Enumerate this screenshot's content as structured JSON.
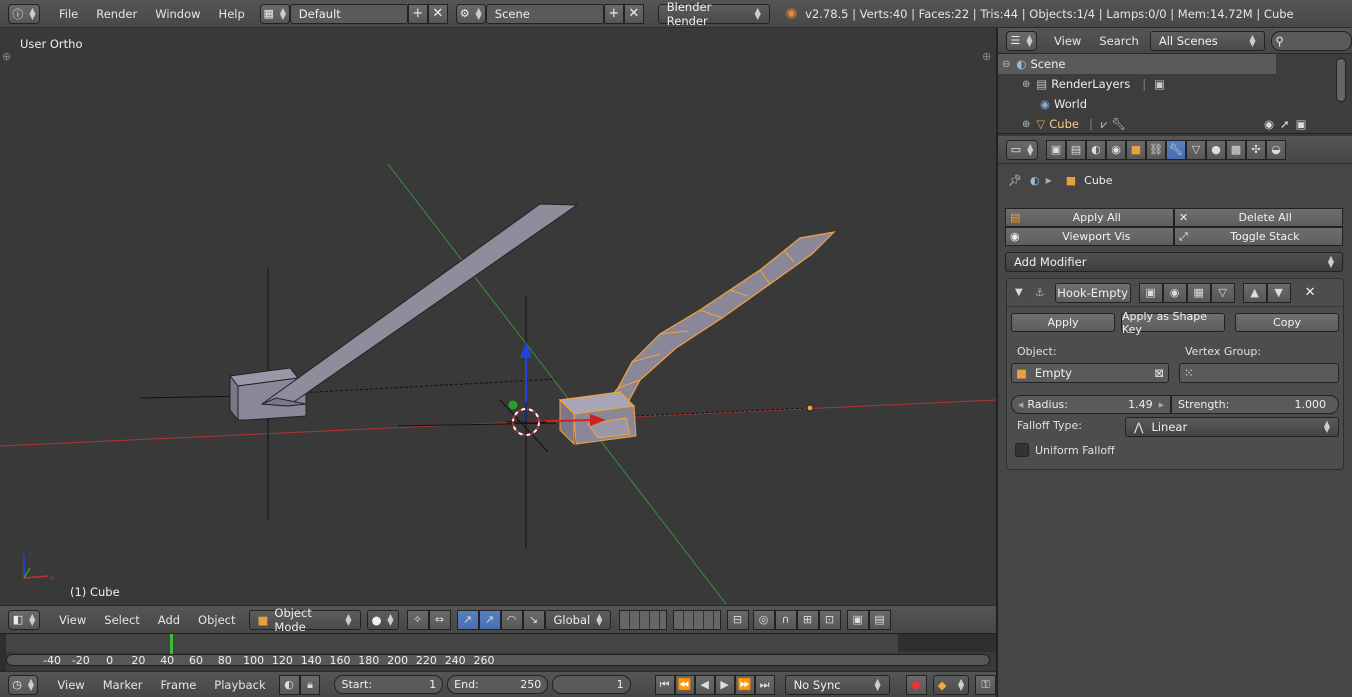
{
  "topbar": {
    "menus": [
      "File",
      "Render",
      "Window",
      "Help"
    ],
    "layout": "Default",
    "scene": "Scene",
    "engine": "Blender Render",
    "stats": "v2.78.5 | Verts:40 | Faces:22 | Tris:44 | Objects:1/4 | Lamps:0/0 | Mem:14.72M | Cube"
  },
  "viewport": {
    "view_name": "User Ortho",
    "object_label": "(1) Cube",
    "colors": {
      "background": "#393939",
      "selected": "#f5a13a",
      "x_axis": "#c03030",
      "y_axis": "#3a9a3a",
      "z_axis": "#2244dd"
    }
  },
  "view3d_header": {
    "menus": [
      "View",
      "Select",
      "Add",
      "Object"
    ],
    "mode": "Object Mode",
    "orientation": "Global"
  },
  "timeline": {
    "ticks": [
      "-40",
      "-20",
      "0",
      "20",
      "40",
      "60",
      "80",
      "100",
      "120",
      "140",
      "160",
      "180",
      "200",
      "220",
      "240",
      "260"
    ],
    "menus": [
      "View",
      "Marker",
      "Frame",
      "Playback"
    ],
    "start_label": "Start:",
    "start_value": "1",
    "end_label": "End:",
    "end_value": "250",
    "current_frame": "1",
    "sync": "No Sync"
  },
  "outliner": {
    "menus": [
      "View",
      "Search"
    ],
    "filter": "All Scenes",
    "rows": [
      "Scene",
      "RenderLayers",
      "World",
      "Cube"
    ]
  },
  "properties": {
    "context_object": "Cube",
    "apply_all": "Apply All",
    "delete_all": "Delete All",
    "viewport_vis": "Viewport Vis",
    "toggle_stack": "Toggle Stack",
    "add_modifier": "Add Modifier",
    "modifier": {
      "name": "Hook-Empty",
      "apply": "Apply",
      "apply_shape": "Apply as Shape Key",
      "copy": "Copy",
      "object_label": "Object:",
      "object_value": "Empty",
      "vertex_group_label": "Vertex Group:",
      "radius_label": "Radius:",
      "radius_value": "1.49",
      "strength_label": "Strength:",
      "strength_value": "1.000",
      "falloff_label": "Falloff Type:",
      "falloff_value": "Linear",
      "uniform_falloff": "Uniform Falloff"
    }
  }
}
